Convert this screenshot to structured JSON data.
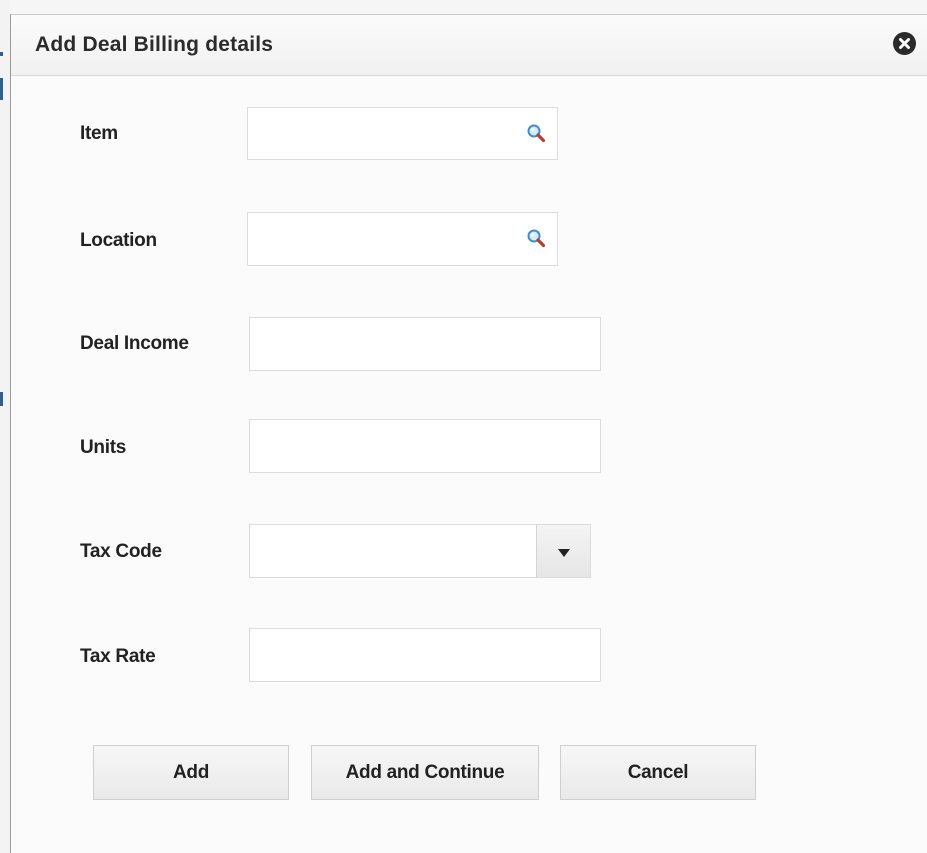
{
  "dialog": {
    "title": "Add Deal Billing details"
  },
  "form": {
    "item": {
      "label": "Item",
      "value": ""
    },
    "location": {
      "label": "Location",
      "value": ""
    },
    "deal_income": {
      "label": "Deal Income",
      "value": ""
    },
    "units": {
      "label": "Units",
      "value": ""
    },
    "tax_code": {
      "label": "Tax Code",
      "value": ""
    },
    "tax_rate": {
      "label": "Tax Rate",
      "value": ""
    }
  },
  "buttons": {
    "add": "Add",
    "add_and_continue": "Add and Continue",
    "cancel": "Cancel"
  },
  "icons": {
    "close": "close-circle-icon",
    "lookup": "magnifier-icon",
    "dropdown": "caret-down-icon"
  },
  "colors": {
    "title_text": "#2b2b2b",
    "close_button": "#2a2a2a",
    "page_edge_accent": "#2e5f8e",
    "magnifier_lens": "#3a8fd0",
    "magnifier_handle": "#c0392b"
  }
}
